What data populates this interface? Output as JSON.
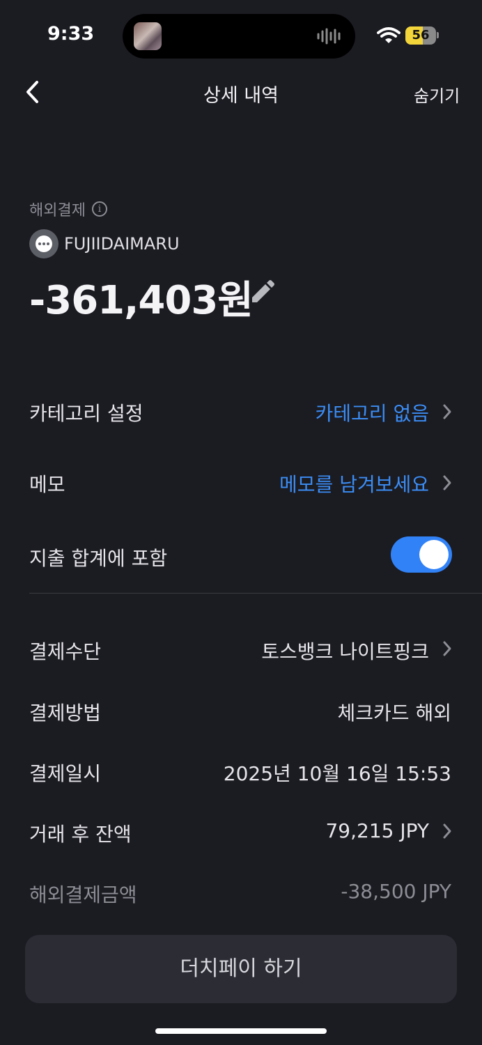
{
  "status_bar": {
    "time": "9:33",
    "battery": "56",
    "battery_level": 0.56
  },
  "nav": {
    "title": "상세 내역",
    "hide_label": "숨기기"
  },
  "transaction": {
    "type_label": "해외결제",
    "merchant": "FUJIIDAIMARU",
    "amount": "-361,403원"
  },
  "settings": {
    "category_label": "카테고리 설정",
    "category_value": "카테고리 없음",
    "memo_label": "메모",
    "memo_value": "메모를 남겨보세요",
    "include_label": "지출 합계에 포함",
    "include_enabled": true
  },
  "details": {
    "method_label": "결제수단",
    "method_value": "토스뱅크 나이트핑크",
    "way_label": "결제방법",
    "way_value": "체크카드 해외",
    "date_label": "결제일시",
    "date_value": "2025년 10월 16일 15:53",
    "balance_label": "거래 후 잔액",
    "balance_value": "79,215 JPY",
    "foreign_label": "해외결제금액",
    "foreign_value": "-38,500 JPY"
  },
  "actions": {
    "dutch_pay": "더치페이 하기"
  },
  "colors": {
    "background": "#1b1b22",
    "accent": "#3182f6",
    "link": "#3b8df4",
    "muted": "#8d8d95"
  }
}
